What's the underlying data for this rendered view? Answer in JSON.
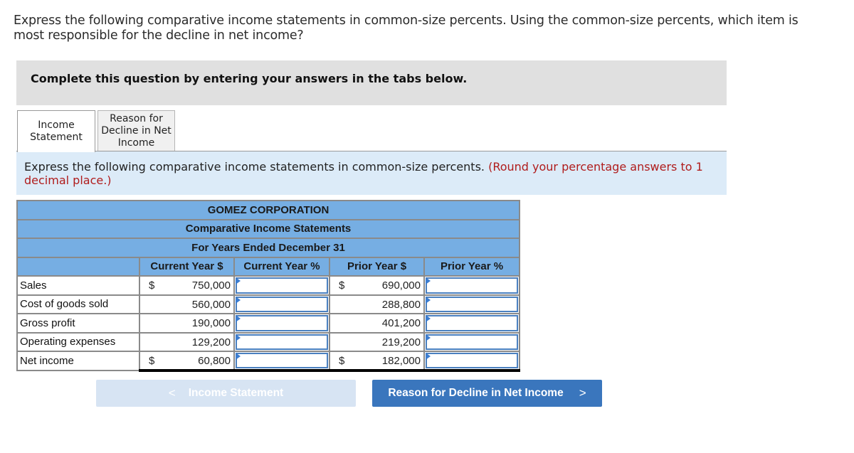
{
  "question": {
    "text": "Express the following comparative income statements in common-size percents. Using the common-size percents, which item is most responsible for the decline in net income?"
  },
  "instruction_bar": {
    "text": "Complete this question by entering your answers in the tabs below."
  },
  "tabs": [
    {
      "label": "Income Statement",
      "active": true
    },
    {
      "label": "Reason for Decline in Net Income",
      "active": false
    }
  ],
  "info": {
    "text": "Express the following comparative income statements in common-size percents.",
    "hint": "(Round your percentage answers to 1 decimal place.)"
  },
  "statement": {
    "company": "GOMEZ CORPORATION",
    "title": "Comparative Income Statements",
    "period": "For Years Ended December 31",
    "columns": [
      "Current Year $",
      "Current Year %",
      "Prior Year $",
      "Prior Year %"
    ],
    "rows": [
      {
        "label": "Sales",
        "current_dollar_sign": "$",
        "current": "750,000",
        "current_pct": "",
        "prior_dollar_sign": "$",
        "prior": "690,000",
        "prior_pct": ""
      },
      {
        "label": "Cost of goods sold",
        "current_dollar_sign": "",
        "current": "560,000",
        "current_pct": "",
        "prior_dollar_sign": "",
        "prior": "288,800",
        "prior_pct": ""
      },
      {
        "label": "Gross profit",
        "current_dollar_sign": "",
        "current": "190,000",
        "current_pct": "",
        "prior_dollar_sign": "",
        "prior": "401,200",
        "prior_pct": ""
      },
      {
        "label": "Operating expenses",
        "current_dollar_sign": "",
        "current": "129,200",
        "current_pct": "",
        "prior_dollar_sign": "",
        "prior": "219,200",
        "prior_pct": ""
      },
      {
        "label": "Net income",
        "current_dollar_sign": "$",
        "current": "60,800",
        "current_pct": "",
        "prior_dollar_sign": "$",
        "prior": "182,000",
        "prior_pct": ""
      }
    ]
  },
  "nav": {
    "prev_label": "Income Statement",
    "prev_icon": "chevron-left-icon",
    "prev_glyph": "<",
    "next_label": "Reason for Decline in Net Income",
    "next_icon": "chevron-right-icon",
    "next_glyph": ">"
  }
}
